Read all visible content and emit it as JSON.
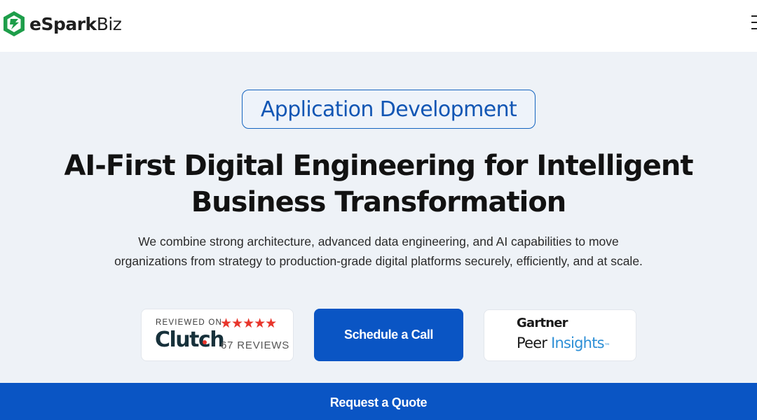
{
  "header": {
    "logo_text_bold": "eSpark",
    "logo_text_thin": "Biz",
    "logo_icon": "espark-logo-icon",
    "menu_icon": "hamburger-menu-icon",
    "brand_color": "#1e9e4a"
  },
  "hero": {
    "category_label": "Application Development",
    "headline_line1": "AI-First Digital Engineering for Intelligent",
    "headline_line2": "Business Transformation",
    "description_line1": "We combine strong architecture, advanced data engineering, and AI capabilities to move",
    "description_line2": "organizations from strategy to production-grade digital platforms securely, efficiently, and at scale.",
    "accent_color": "#0a55c4"
  },
  "clutch": {
    "reviewed_on": "REVIEWED ON",
    "stars": "★★★★★",
    "rating": 5,
    "logo_text": "Clutch",
    "reviews": "67 REVIEWS",
    "star_color": "#e8352b"
  },
  "cta": {
    "schedule_label": "Schedule a Call"
  },
  "gartner": {
    "name": "Gartner",
    "peer": "Peer ",
    "insights": "Insights",
    "tm": "™"
  },
  "footer": {
    "quote_label": "Request a Quote"
  }
}
